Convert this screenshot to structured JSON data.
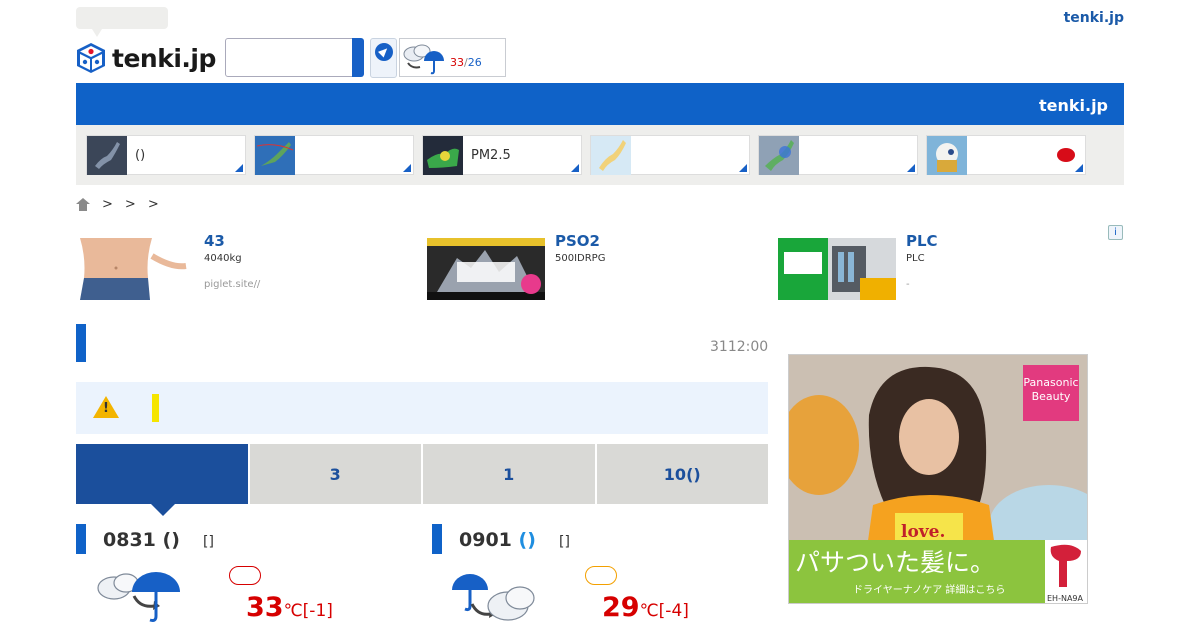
{
  "header": {
    "logo_text": "tenki.jp",
    "top_link": "tenki.jp",
    "mini_forecast": {
      "high": "33",
      "low": "26",
      "separator": "/"
    }
  },
  "bluebar": {
    "label": "tenki.jp"
  },
  "tiles": [
    {
      "label": "()",
      "flag": false
    },
    {
      "label": "",
      "flag": false
    },
    {
      "label": "PM2.5",
      "flag": false
    },
    {
      "label": "",
      "flag": false
    },
    {
      "label": "",
      "flag": false
    },
    {
      "label": "",
      "flag": true
    }
  ],
  "breadcrumb": [
    ">",
    ">",
    ">"
  ],
  "ads": [
    {
      "headline": "43",
      "desc": "4040kg",
      "source": "piglet.site//"
    },
    {
      "headline": "PSO2",
      "desc": "500IDRPG",
      "source": ""
    },
    {
      "headline": "PLC",
      "desc": "PLC",
      "source": "-"
    }
  ],
  "ad_info": "i",
  "section": {
    "time": "3112:00"
  },
  "tabs": [
    {
      "label": "",
      "active": true
    },
    {
      "label": "3",
      "active": false
    },
    {
      "label": "1",
      "active": false
    },
    {
      "label": "10()",
      "active": false
    }
  ],
  "days": [
    {
      "date": "0831",
      "weekday": "()",
      "weekday_color": "#333333",
      "bracket": "[]",
      "high": "33",
      "unit": "℃",
      "diff": "[-1]",
      "pill_color": "#d60000"
    },
    {
      "date": "0901",
      "weekday": "()",
      "weekday_color": "#1f8ee0",
      "bracket": "[]",
      "high": "29",
      "unit": "℃",
      "diff": "[-4]",
      "pill_color": "#f3a000"
    }
  ],
  "big_ad": {
    "brand": "Panasonic Beauty",
    "slogan": "パサついた髪に。",
    "sub": "ドライヤーナノケア 詳細はこちら",
    "model": "EH-NA9A",
    "shirt_text": "love."
  },
  "colors": {
    "brand_blue": "#0f62c8",
    "tab_blue": "#1b4f9c",
    "temp_red": "#d60000"
  }
}
